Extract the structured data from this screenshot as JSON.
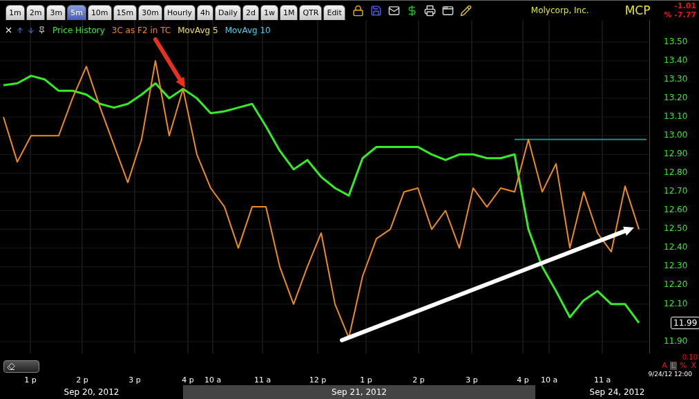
{
  "toolbar": {
    "tabs": [
      {
        "label": "1m",
        "selected": false
      },
      {
        "label": "2m",
        "selected": false
      },
      {
        "label": "3m",
        "selected": false
      },
      {
        "label": "5m",
        "selected": true
      },
      {
        "label": "10m",
        "selected": false
      },
      {
        "label": "15m",
        "selected": false
      },
      {
        "label": "30m",
        "selected": false
      },
      {
        "label": "Hourly",
        "selected": false
      },
      {
        "label": "4h",
        "selected": false
      },
      {
        "label": "Daily",
        "selected": false
      },
      {
        "label": "2d",
        "selected": false
      },
      {
        "label": "1w",
        "selected": false
      },
      {
        "label": "1M",
        "selected": false
      },
      {
        "label": "QTR",
        "selected": false
      },
      {
        "label": "Edit",
        "selected": false
      }
    ],
    "company": "Molycorp, Inc.",
    "ticker": "MCP",
    "change": "-1.01",
    "change_percent": "% -7.77"
  },
  "legend_extra": [
    {
      "label": "MovAvg 5",
      "color": "#f2e24a"
    },
    {
      "label": "MovAvg 10",
      "color": "#3fd8f0"
    }
  ],
  "chart": {
    "chart_data": {
      "type": "line",
      "ylim": [
        11.837,
        13.618
      ],
      "yticks": [
        {
          "value": 11.9,
          "label": "11.90"
        },
        {
          "value": 12.1,
          "label": "12.10"
        },
        {
          "value": 12.2,
          "label": "12.20"
        },
        {
          "value": 12.3,
          "label": "12.30"
        },
        {
          "value": 12.4,
          "label": "12.40"
        },
        {
          "value": 12.5,
          "label": "12.50"
        },
        {
          "value": 12.6,
          "label": "12.60"
        },
        {
          "value": 12.7,
          "label": "12.70"
        },
        {
          "value": 12.8,
          "label": "12.80"
        },
        {
          "value": 12.9,
          "label": "12.90"
        },
        {
          "value": 13.0,
          "label": "13.00"
        },
        {
          "value": 13.1,
          "label": "13.10"
        },
        {
          "value": 13.2,
          "label": "13.20"
        },
        {
          "value": 13.3,
          "label": "13.30"
        },
        {
          "value": 13.4,
          "label": "13.40"
        },
        {
          "value": 13.5,
          "label": "13.50"
        }
      ],
      "grid": true,
      "ref_lines": [
        {
          "axis": "y",
          "value": 12.98,
          "color": "#1f8f86"
        }
      ],
      "series": [
        {
          "name": "Price History",
          "color": "#33ee22",
          "values": [
            13.27,
            13.28,
            13.32,
            13.3,
            13.24,
            13.24,
            13.22,
            13.17,
            13.15,
            13.17,
            13.22,
            13.28,
            13.2,
            13.25,
            13.2,
            13.12,
            13.13,
            13.15,
            13.17,
            13.05,
            12.92,
            12.82,
            12.87,
            12.78,
            12.72,
            12.68,
            12.88,
            12.94,
            12.94,
            12.94,
            12.94,
            12.9,
            12.87,
            12.9,
            12.9,
            12.88,
            12.88,
            12.9,
            12.5,
            12.3,
            12.17,
            12.03,
            12.12,
            12.17,
            12.1,
            12.1,
            12.0
          ]
        },
        {
          "name": "3C as F2 in TC",
          "color": "#f08c1a",
          "values": [
            13.1,
            12.86,
            13.0,
            13.0,
            13.0,
            13.2,
            13.37,
            13.15,
            12.95,
            12.75,
            12.98,
            13.4,
            13.0,
            13.25,
            12.9,
            12.72,
            12.62,
            12.4,
            12.62,
            12.62,
            12.3,
            12.1,
            12.3,
            12.48,
            12.1,
            11.92,
            12.25,
            12.45,
            12.5,
            12.7,
            12.72,
            12.5,
            12.6,
            12.4,
            12.72,
            12.62,
            12.72,
            12.7,
            12.98,
            12.7,
            12.85,
            12.4,
            12.7,
            12.48,
            12.38,
            12.73,
            12.5
          ]
        }
      ]
    },
    "markings": [
      {
        "kind": "arrow",
        "color": "#e8321e"
      },
      {
        "kind": "arrow",
        "color": "#ffffff"
      }
    ],
    "time_labels": [
      "1 p",
      "2 p",
      "3 p",
      "4 p",
      "10 a",
      "11 a",
      "12 p",
      "1 p",
      "2 p",
      "3 p",
      "4 p",
      "10 a",
      "11 a"
    ],
    "last_price": "11.99",
    "scale_value": "0.10",
    "scale_buttons": [
      {
        "label": "A",
        "selected": false
      },
      {
        "label": "L",
        "selected": true
      },
      {
        "label": "%",
        "selected": false
      },
      {
        "label": "X",
        "selected": false
      }
    ],
    "timestamp": "9/24/12 12:00"
  },
  "dates": [
    {
      "label": "Sep 20, 2012",
      "selected": false
    },
    {
      "label": "Sep 21, 2012",
      "selected": true
    },
    {
      "label": "Sep 24, 2012",
      "selected": false
    }
  ]
}
